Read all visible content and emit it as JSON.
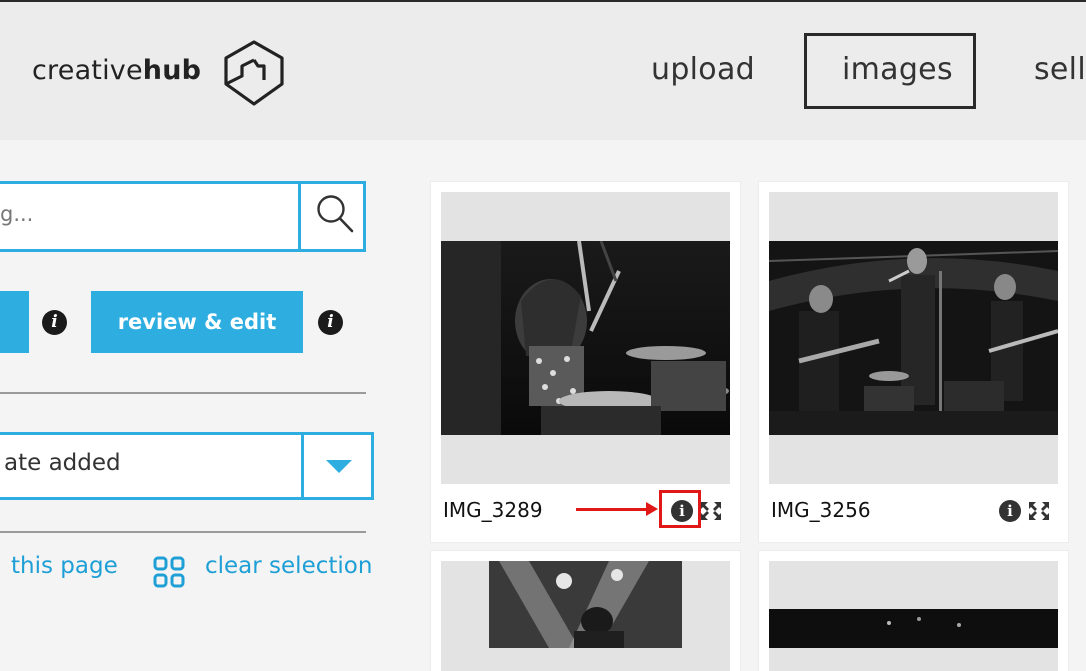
{
  "header": {
    "brand_light": "creative",
    "brand_bold": "hub",
    "nav": {
      "upload": "upload",
      "images": "images",
      "sell": "sell"
    }
  },
  "sidebar": {
    "search_placeholder": "g...",
    "review_button": "review & edit",
    "sort_value": "ate added",
    "link_this_page": "this page",
    "link_clear_selection": "clear selection"
  },
  "cards": [
    {
      "name": "IMG_3289"
    },
    {
      "name": "IMG_3256"
    }
  ],
  "colors": {
    "accent": "#2eaee0",
    "link": "#1e9fd6",
    "highlight": "#e01818",
    "header_bg": "#ececec",
    "page_bg": "#f4f4f4"
  },
  "icons": {
    "search": "search-icon",
    "info": "info-icon",
    "expand": "expand-icon",
    "grid": "grid-icon",
    "dropdown": "chevron-down-icon",
    "logo": "creativehub-logo"
  }
}
